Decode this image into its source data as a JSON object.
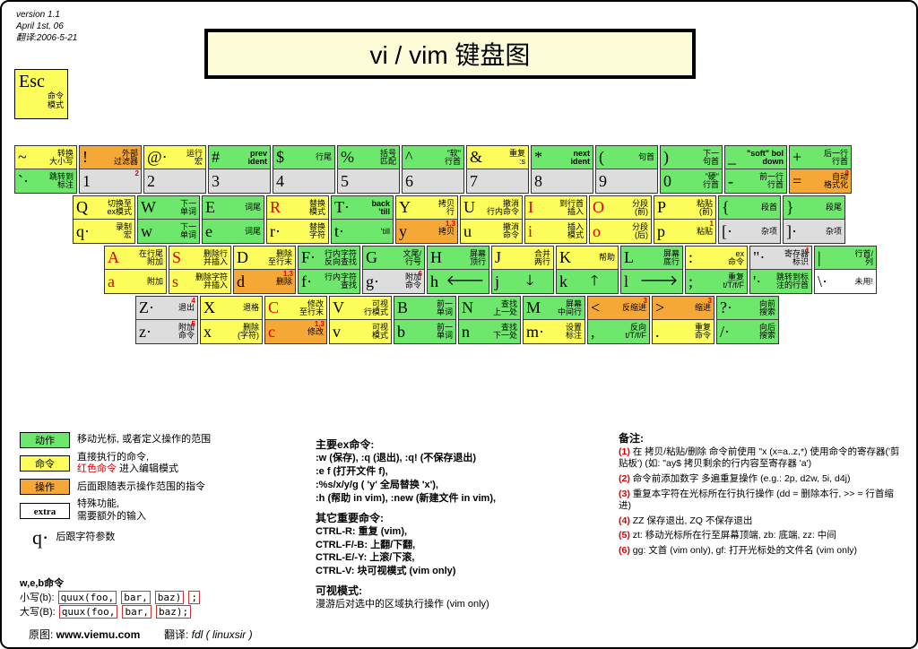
{
  "meta": {
    "version": "version 1.1",
    "date": "April 1st, 06",
    "trans": "翻译:2006-5-21"
  },
  "title": "vi / vim 键盘图",
  "esc": {
    "label": "Esc",
    "desc1": "命令",
    "desc2": "模式"
  },
  "rows": [
    [
      {
        "t": [
          "~",
          "转换\n大小写",
          "c-y"
        ],
        "b": [
          "`·",
          "跳转到\n标注",
          "c-g"
        ]
      },
      {
        "t": [
          "!",
          "外部\n过滤器",
          "c-o"
        ],
        "b": [
          "1",
          "",
          "c-gr",
          "2"
        ]
      },
      {
        "t": [
          "@·",
          "运行\n宏",
          "c-y"
        ],
        "b": [
          "2",
          "",
          "c-gr"
        ]
      },
      {
        "t": [
          "#",
          "prev\nident",
          "c-g",
          "",
          true
        ],
        "b": [
          "3",
          "",
          "c-gr"
        ]
      },
      {
        "t": [
          "$",
          "行尾",
          "c-g"
        ],
        "b": [
          "4",
          "",
          "c-gr"
        ]
      },
      {
        "t": [
          "%",
          "括号\n匹配",
          "c-g"
        ],
        "b": [
          "5",
          "",
          "c-gr"
        ]
      },
      {
        "t": [
          "^",
          "\"软\"\n行首",
          "c-g"
        ],
        "b": [
          "6",
          "",
          "c-gr"
        ]
      },
      {
        "t": [
          "&",
          "重复\n:s",
          "c-y"
        ],
        "b": [
          "7",
          "",
          "c-gr"
        ]
      },
      {
        "t": [
          "*",
          "next\nident",
          "c-g",
          "",
          true
        ],
        "b": [
          "8",
          "",
          "c-gr"
        ]
      },
      {
        "t": [
          "(",
          "句首",
          "c-g"
        ],
        "b": [
          "9",
          "",
          "c-gr"
        ]
      },
      {
        "t": [
          ")",
          "下一\n句首",
          "c-g"
        ],
        "b": [
          "0",
          "\"硬\"\n行首",
          "c-g"
        ]
      },
      {
        "t": [
          "_",
          "\"soft\" bol\ndown",
          "c-g",
          "",
          true
        ],
        "b": [
          "-",
          "前一行\n行首",
          "c-g"
        ]
      },
      {
        "t": [
          "+",
          "后一行\n行首",
          "c-g"
        ],
        "b": [
          "=",
          "自动\n格式化",
          "c-o",
          "3"
        ]
      }
    ],
    [
      {
        "t": [
          "Q",
          "切换至\nex模式",
          "c-y"
        ],
        "b": [
          "q·",
          "录制\n宏",
          "c-y"
        ]
      },
      {
        "t": [
          "W",
          "下一\n单词",
          "c-g"
        ],
        "b": [
          "w",
          "下一\n单词",
          "c-g"
        ]
      },
      {
        "t": [
          "E",
          "词尾",
          "c-g"
        ],
        "b": [
          "e",
          "词尾",
          "c-g"
        ]
      },
      {
        "t": [
          "R",
          "替换\n模式",
          "c-y",
          "",
          false,
          true
        ],
        "b": [
          "r·",
          "替换\n字符",
          "c-y"
        ]
      },
      {
        "t": [
          "T·",
          "back\n'till",
          "c-g",
          "",
          true
        ],
        "b": [
          "t·",
          "'till",
          "c-g"
        ]
      },
      {
        "t": [
          "Y",
          "拷贝\n行",
          "c-y"
        ],
        "b": [
          "y",
          "拷贝",
          "c-o",
          "1,3"
        ]
      },
      {
        "t": [
          "U",
          "撤消\n行内命令",
          "c-y"
        ],
        "b": [
          "u",
          "撤消\n命令",
          "c-y"
        ]
      },
      {
        "t": [
          "I",
          "到行首\n插入",
          "c-y",
          "",
          false,
          true
        ],
        "b": [
          "i",
          "插入\n模式",
          "c-y",
          "",
          false,
          true
        ]
      },
      {
        "t": [
          "O",
          "分段\n(前)",
          "c-y",
          "",
          false,
          true
        ],
        "b": [
          "o",
          "分段\n(后)",
          "c-y",
          "",
          false,
          true
        ]
      },
      {
        "t": [
          "P",
          "粘贴\n(前)",
          "c-y"
        ],
        "b": [
          "p",
          "粘贴",
          "c-y",
          "1"
        ]
      },
      {
        "t": [
          "{",
          "段首",
          "c-g"
        ],
        "b": [
          "[·",
          "杂项",
          "c-gr"
        ]
      },
      {
        "t": [
          "}",
          "段尾",
          "c-g"
        ],
        "b": [
          "]·",
          "杂项",
          "c-gr"
        ]
      }
    ],
    [
      {
        "t": [
          "A",
          "在行尾\n附加",
          "c-y",
          "",
          false,
          true
        ],
        "b": [
          "a",
          "附加",
          "c-y",
          "",
          false,
          true
        ]
      },
      {
        "t": [
          "S",
          "删除行\n并插入",
          "c-y",
          "",
          false,
          true
        ],
        "b": [
          "s",
          "删除字符\n并插入",
          "c-y",
          "",
          false,
          true
        ]
      },
      {
        "t": [
          "D",
          "删除\n至行末",
          "c-y"
        ],
        "b": [
          "d",
          "删除",
          "c-o",
          "1,3"
        ]
      },
      {
        "t": [
          "F·",
          "行内字符\n反向查找",
          "c-g"
        ],
        "b": [
          "f·",
          "行内字符\n查找",
          "c-g"
        ]
      },
      {
        "t": [
          "G",
          "文尾/\n行号",
          "c-g"
        ],
        "b": [
          "g·",
          "附加\n命令",
          "c-gr",
          "6"
        ]
      },
      {
        "t": [
          "H",
          "屏幕\n顶行",
          "c-g"
        ],
        "b": [
          "h",
          "←",
          "c-g",
          "",
          false,
          false,
          true
        ]
      },
      {
        "t": [
          "J",
          "合并\n两行",
          "c-y"
        ],
        "b": [
          "j",
          "↓",
          "c-g",
          "",
          false,
          false,
          true
        ]
      },
      {
        "t": [
          "K",
          "帮助",
          "c-y"
        ],
        "b": [
          "k",
          "↑",
          "c-g",
          "",
          false,
          false,
          true
        ]
      },
      {
        "t": [
          "L",
          "屏幕\n底行",
          "c-g"
        ],
        "b": [
          "l",
          "→",
          "c-g",
          "",
          false,
          false,
          true
        ]
      },
      {
        "t": [
          ":",
          "ex\n命令",
          "c-y"
        ],
        "b": [
          ";",
          "重复\nt/T/f/F",
          "c-g"
        ]
      },
      {
        "t": [
          "\"·",
          "寄存器\n标识",
          "c-gr",
          "1"
        ],
        "b": [
          "'·",
          "跳转到标\n注的行首",
          "c-g"
        ]
      },
      {
        "t": [
          "|",
          "行首/\n列",
          "c-g"
        ],
        "b": [
          "\\·",
          "未用!",
          "c-w"
        ]
      }
    ],
    [
      {
        "t": [
          "Z·",
          "退出",
          "c-gr",
          "4"
        ],
        "b": [
          "z·",
          "附加\n命令",
          "c-gr",
          "5"
        ]
      },
      {
        "t": [
          "X",
          "退格",
          "c-y"
        ],
        "b": [
          "x",
          "删除\n(字符)",
          "c-y"
        ]
      },
      {
        "t": [
          "C",
          "修改\n至行末",
          "c-y",
          "",
          false,
          true
        ],
        "b": [
          "c",
          "修改",
          "c-o",
          "1,3",
          false,
          true
        ]
      },
      {
        "t": [
          "V",
          "可视\n行模式",
          "c-y"
        ],
        "b": [
          "v",
          "可视\n模式",
          "c-y"
        ]
      },
      {
        "t": [
          "B",
          "前一\n单词",
          "c-g"
        ],
        "b": [
          "b",
          "前一\n单词",
          "c-g"
        ]
      },
      {
        "t": [
          "N",
          "查找\n上一处",
          "c-g"
        ],
        "b": [
          "n",
          "查找\n下一处",
          "c-g"
        ]
      },
      {
        "t": [
          "M",
          "屏幕\n中间行",
          "c-g"
        ],
        "b": [
          "m·",
          "设置\n标注",
          "c-y"
        ]
      },
      {
        "t": [
          "<",
          "反缩进",
          "c-o",
          "3"
        ],
        "b": [
          ",",
          "反向\nt/T/f/F",
          "c-g"
        ]
      },
      {
        "t": [
          ">",
          "缩进",
          "c-o",
          "3"
        ],
        "b": [
          ".",
          "重复\n命令",
          "c-y"
        ]
      },
      {
        "t": [
          "?·",
          "向前\n搜索",
          "c-g"
        ],
        "b": [
          "/·",
          "向后\n搜索",
          "c-g"
        ]
      }
    ]
  ],
  "rowOffsets": [
    0,
    65,
    100,
    135
  ],
  "legend": [
    {
      "box": "动作",
      "cls": "c-g",
      "text": "移动光标, 或者定义操作的范围"
    },
    {
      "box": "命令",
      "cls": "c-y",
      "text": "直接执行的命令,\n",
      "red": "红色命令",
      "text2": " 进入编辑模式"
    },
    {
      "box": "操作",
      "cls": "c-o",
      "text": "后面跟随表示操作范围的指令"
    },
    {
      "box": "extra",
      "cls": "c-w",
      "text": "特殊功能,\n需要额外的输入"
    },
    {
      "sym": "q·",
      "text": "后跟字符参数"
    }
  ],
  "wb": {
    "title": "w,e,b命令",
    "lower": "小写(b):",
    "lower_code": [
      "quux(foo,",
      "bar,",
      "baz)",
      ";"
    ],
    "upper": "大写(B):",
    "upper_code": [
      "quux(foo,",
      "bar,",
      "baz);"
    ]
  },
  "ex": {
    "h1": "主要ex命令:",
    "l1": ":w (保存), :q (退出), :q! (不保存退出)",
    "l2": ":e f (打开文件 f),",
    "l3": ":%s/x/y/g ( 'y' 全局替换 'x'),",
    "l4": ":h (帮助  in vim), :new (新建文件  in vim),",
    "h2": "其它重要命令:",
    "l5": "CTRL-R: 重复  (vim),",
    "l6": "CTRL-F/-B: 上翻/下翻,",
    "l7": "CTRL-E/-Y: 上滚/下滚,",
    "l8": "CTRL-V: 块可视模式  (vim only)",
    "h3": "可视模式:",
    "l9": "漫游后对选中的区域执行操作  (vim only)"
  },
  "notes": {
    "title": "备注:",
    "items": [
      "在  拷贝/粘贴/删除  命令前使用  \"x (x=a..z,*)  使用命令的寄存器('剪贴板')  (如: \"ay$ 拷贝剩余的行内容至寄存器  'a')",
      "命令前添加数字  多遍重复操作  (e.g.: 2p, d2w, 5i, d4j)",
      "重复本字符在光标所在行执行操作  (dd = 删除本行, >> = 行首缩进)",
      "ZZ 保存退出, ZQ 不保存退出",
      "zt: 移动光标所在行至屏幕顶端,  zb: 底端, zz: 中间",
      "gg: 文首  (vim only),  gf: 打开光标处的文件名  (vim only)"
    ]
  },
  "footer": {
    "src": "原图: ",
    "url": "www.viemu.com",
    "tr": "翻译:  ",
    "name": "fdl  ( linuxsir )"
  }
}
